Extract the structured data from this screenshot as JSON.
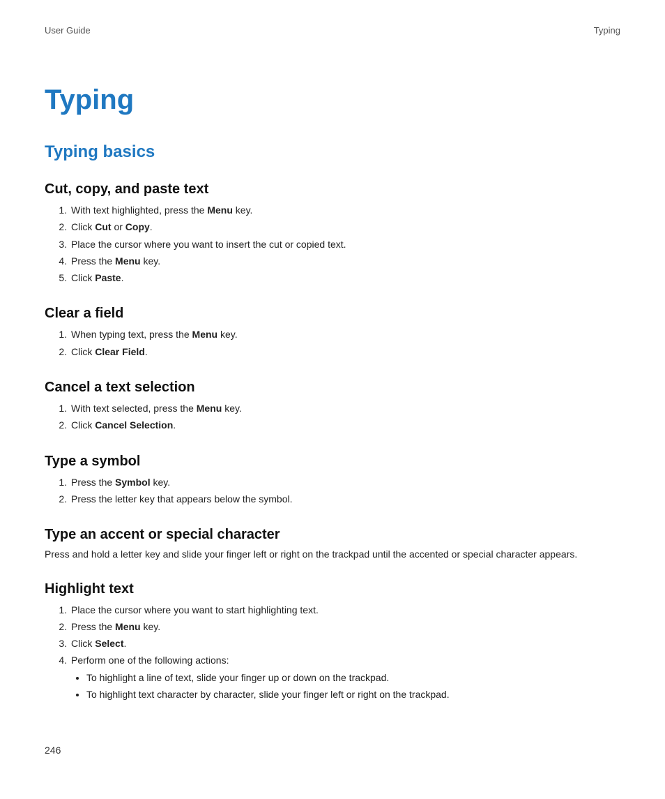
{
  "header": {
    "left": "User Guide",
    "right": "Typing"
  },
  "title": "Typing",
  "section": "Typing basics",
  "page_number": "246",
  "cut_copy_paste": {
    "heading": "Cut, copy, and paste text",
    "steps": [
      {
        "pre": "With text highlighted, press the ",
        "b1": "Menu",
        "post": " key."
      },
      {
        "pre": "Click ",
        "b1": "Cut",
        "mid": " or ",
        "b2": "Copy",
        "post": "."
      },
      {
        "pre": "Place the cursor where you want to insert the cut or copied text."
      },
      {
        "pre": "Press the ",
        "b1": "Menu",
        "post": " key."
      },
      {
        "pre": "Click ",
        "b1": "Paste",
        "post": "."
      }
    ]
  },
  "clear_field": {
    "heading": "Clear a field",
    "steps": [
      {
        "pre": "When typing text, press the ",
        "b1": "Menu",
        "post": " key."
      },
      {
        "pre": "Click ",
        "b1": "Clear Field",
        "post": "."
      }
    ]
  },
  "cancel_selection": {
    "heading": "Cancel a text selection",
    "steps": [
      {
        "pre": "With text selected, press the ",
        "b1": "Menu",
        "post": " key."
      },
      {
        "pre": "Click ",
        "b1": "Cancel Selection",
        "post": "."
      }
    ]
  },
  "type_symbol": {
    "heading": "Type a symbol",
    "steps": [
      {
        "pre": "Press the ",
        "b1": "Symbol",
        "post": " key."
      },
      {
        "pre": "Press the letter key that appears below the symbol."
      }
    ]
  },
  "type_accent": {
    "heading": "Type an accent or special character",
    "para": "Press and hold a letter key and slide your finger left or right on the trackpad until the accented or special character appears."
  },
  "highlight_text": {
    "heading": "Highlight text",
    "steps": [
      {
        "pre": "Place the cursor where you want to start highlighting text."
      },
      {
        "pre": "Press the ",
        "b1": "Menu",
        "post": " key."
      },
      {
        "pre": "Click ",
        "b1": "Select",
        "post": "."
      },
      {
        "pre": "Perform one of the following actions:",
        "bullets": [
          "To highlight a line of text, slide your finger up or down on the trackpad.",
          "To highlight text character by character, slide your finger left or right on the trackpad."
        ]
      }
    ]
  }
}
